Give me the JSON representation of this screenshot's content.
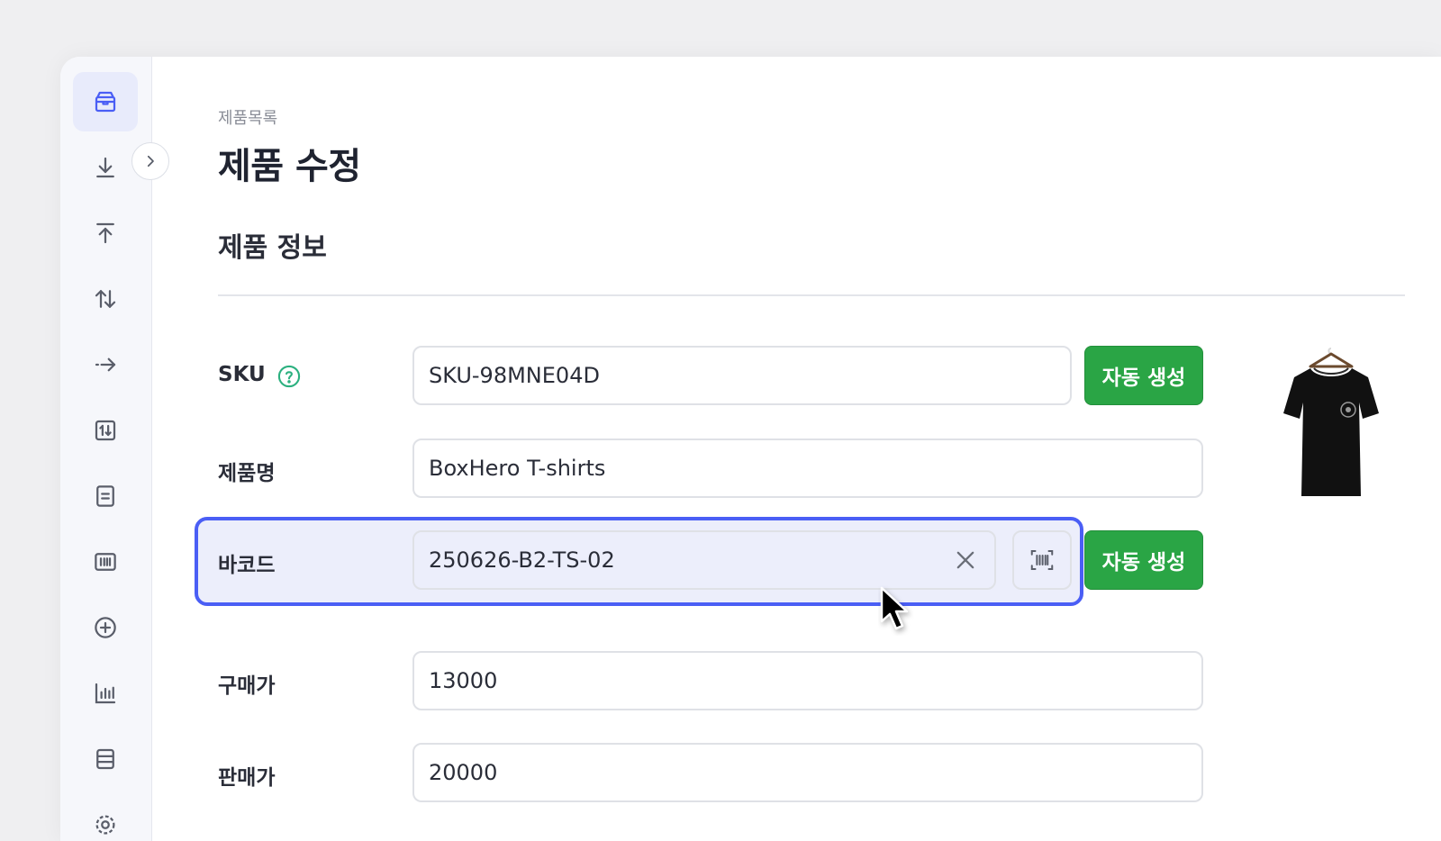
{
  "breadcrumb": "제품목록",
  "page_title": "제품 수정",
  "section_title": "제품 정보",
  "fields": {
    "sku": {
      "label": "SKU",
      "value": "SKU-98MNE04D",
      "auto_label": "자동 생성"
    },
    "name": {
      "label": "제품명",
      "value": "BoxHero T-shirts"
    },
    "barcode": {
      "label": "바코드",
      "value": "250626-B2-TS-02",
      "auto_label": "자동 생성"
    },
    "purchase_price": {
      "label": "구매가",
      "value": "13000"
    },
    "sale_price": {
      "label": "판매가",
      "value": "20000"
    }
  },
  "sidebar": {
    "items": [
      {
        "icon": "box-icon",
        "active": true
      },
      {
        "icon": "stock-in-icon"
      },
      {
        "icon": "stock-out-icon"
      },
      {
        "icon": "adjust-icon"
      },
      {
        "icon": "move-icon"
      },
      {
        "icon": "transaction-icon"
      },
      {
        "icon": "document-icon"
      },
      {
        "icon": "barcode-icon"
      },
      {
        "icon": "add-circle-icon"
      },
      {
        "icon": "chart-icon"
      },
      {
        "icon": "list-icon"
      },
      {
        "icon": "settings-icon"
      }
    ]
  },
  "colors": {
    "accent": "#4a5ef5",
    "green": "#2aa545",
    "help": "#2bb07f"
  }
}
